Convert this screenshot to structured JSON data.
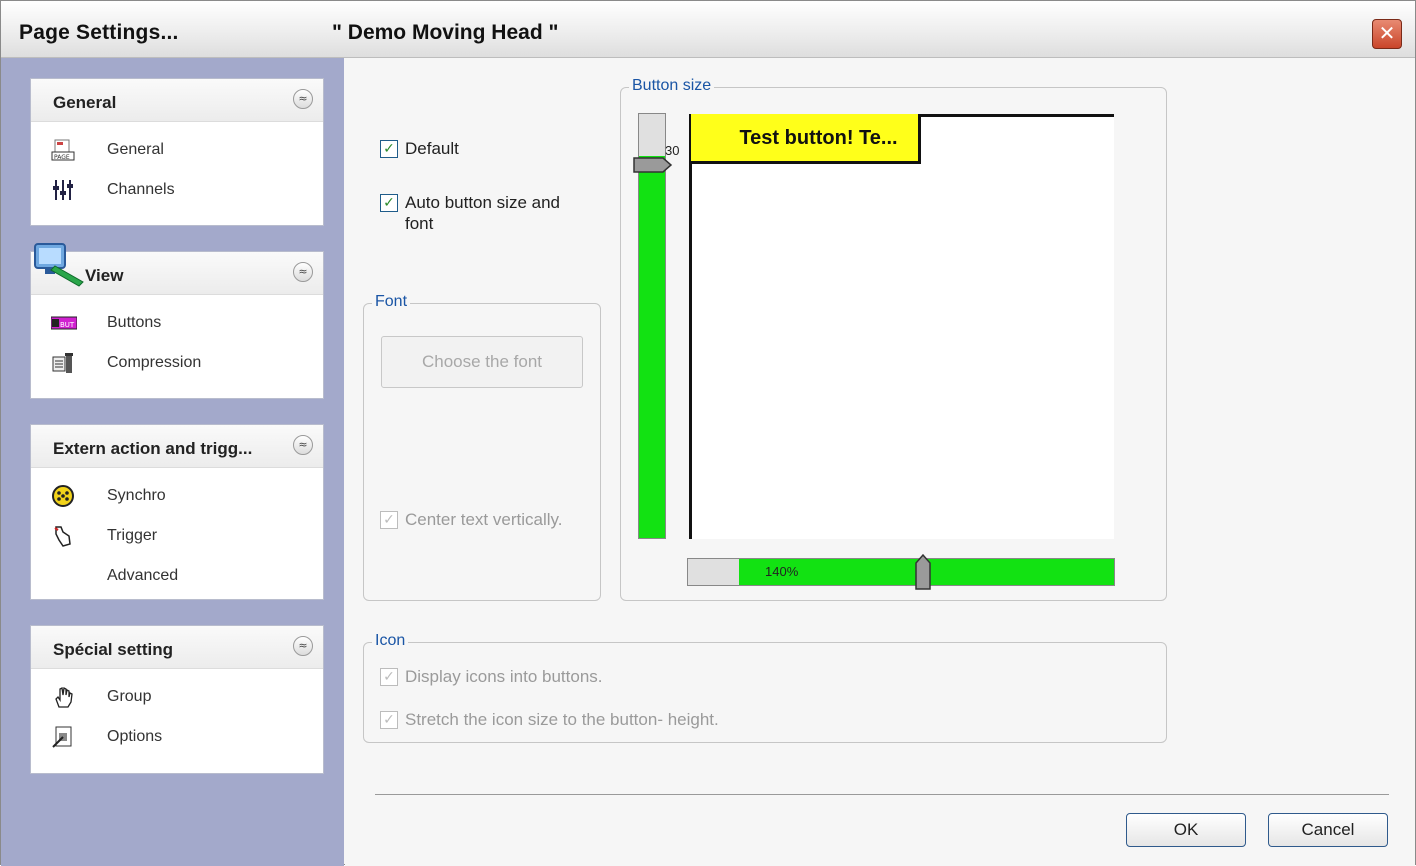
{
  "window": {
    "title_left": "Page  Settings...",
    "title_right": "\" Demo Moving Head \"",
    "close_symbol": "✕"
  },
  "sidebar": {
    "panels": [
      {
        "title": "General",
        "items": [
          {
            "label": "General",
            "icon": "page-icon"
          },
          {
            "label": "Channels",
            "icon": "faders-icon"
          }
        ]
      },
      {
        "title": "View",
        "items": [
          {
            "label": "Buttons",
            "icon": "buttons-icon"
          },
          {
            "label": "Compression",
            "icon": "compression-icon"
          }
        ]
      },
      {
        "title": "Extern action and trigg...",
        "items": [
          {
            "label": "Synchro",
            "icon": "dmx-connector-icon"
          },
          {
            "label": "Trigger",
            "icon": "trigger-hand-icon"
          },
          {
            "label": "Advanced",
            "icon": ""
          }
        ]
      },
      {
        "title": "Spécial setting",
        "items": [
          {
            "label": "Group",
            "icon": "hand-pointer-icon"
          },
          {
            "label": "Options",
            "icon": "options-doc-icon"
          }
        ]
      }
    ],
    "collapse_symbol": "≈"
  },
  "main": {
    "default_checkbox": {
      "label": "Default",
      "checked": true
    },
    "auto_size_checkbox": {
      "label_line1": "Auto button size and",
      "label_line2": "font",
      "checked": true
    },
    "font_group": {
      "legend": "Font",
      "choose_font_button": "Choose the font",
      "center_vertically": {
        "label": "Center text vertically.",
        "checked": true,
        "enabled": false
      }
    },
    "button_size_group": {
      "legend": "Button size",
      "vertical_slider_value": "30",
      "vertical_slider_fraction": 0.9,
      "test_button_text": "Test button! Te...",
      "horizontal_slider_value": "140%",
      "horizontal_slider_fraction": 0.88
    },
    "icon_group": {
      "legend": "Icon",
      "display_icons": {
        "label": "Display icons into buttons.",
        "checked": true,
        "enabled": false
      },
      "stretch_icon": {
        "label": "Stretch the icon size to the button- height.",
        "checked": true,
        "enabled": false
      }
    }
  },
  "footer": {
    "ok_label": "OK",
    "cancel_label": "Cancel"
  },
  "colors": {
    "sidebar_bg": "#a3a9cb",
    "slider_fill": "#12e212",
    "test_button_bg": "#ffff1a",
    "legend_text": "#1a55a5"
  }
}
